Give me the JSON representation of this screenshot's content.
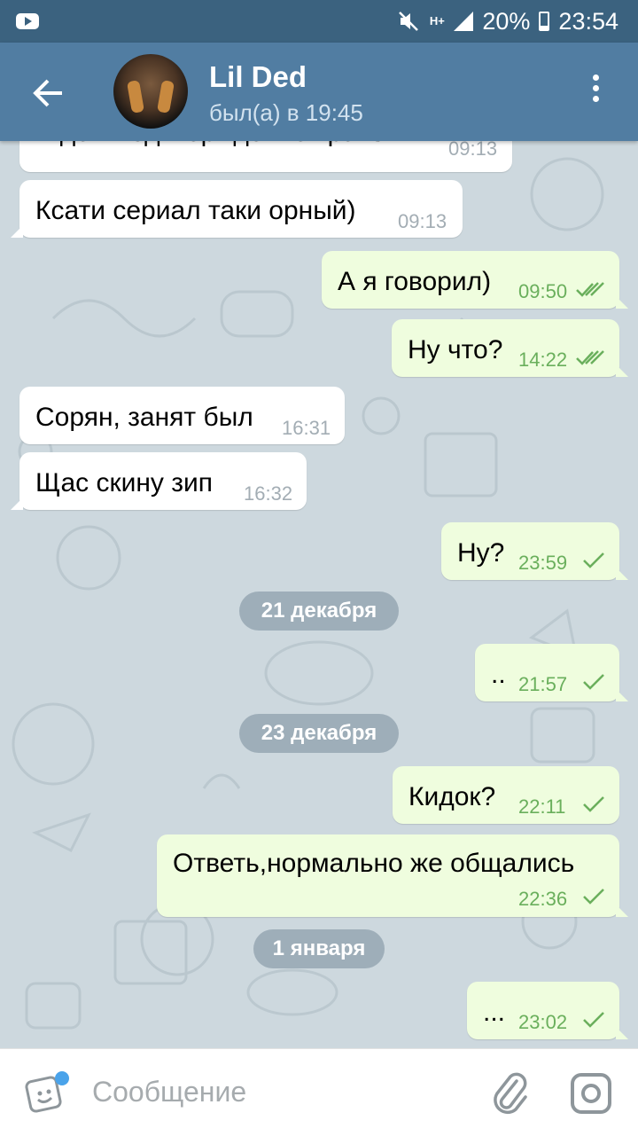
{
  "status_bar": {
    "network": "H+",
    "battery": "20%",
    "time": "23:54"
  },
  "header": {
    "contact_name": "Lil Ded",
    "status": "был(а) в 19:45"
  },
  "messages": [
    {
      "dir": "in",
      "text": "Ждем подтверждение транзы",
      "time": "09:13"
    },
    {
      "dir": "in",
      "text": "Ксати сериал таки орный)",
      "time": "09:13"
    },
    {
      "dir": "out",
      "text": "А я говорил)",
      "time": "09:50",
      "read": true
    },
    {
      "dir": "out",
      "text": "Ну что?",
      "time": "14:22",
      "read": true
    },
    {
      "dir": "in",
      "text": "Сорян, занят был",
      "time": "16:31"
    },
    {
      "dir": "in",
      "text": "Щас скину зип",
      "time": "16:32"
    },
    {
      "dir": "out",
      "text": "Ну?",
      "time": "23:59",
      "read": false
    },
    {
      "dir": "out",
      "text": "..",
      "time": "21:57",
      "read": false
    },
    {
      "dir": "out",
      "text": "Кидок?",
      "time": "22:11",
      "read": false
    },
    {
      "dir": "out",
      "text": "Ответь,нормально же общались",
      "time": "22:36",
      "read": false
    },
    {
      "dir": "out",
      "text": "...",
      "time": "23:02",
      "read": false
    }
  ],
  "date_separators": [
    "21 декабря",
    "23 декабря",
    "1 января"
  ],
  "input": {
    "placeholder": "Сообщение"
  },
  "colors": {
    "header": "#517da2",
    "status_bar": "#3b627f",
    "outgoing_bubble": "#effdde",
    "incoming_bubble": "#ffffff",
    "check_color": "#6aaf5c",
    "notification_dot": "#4aa3ea"
  }
}
